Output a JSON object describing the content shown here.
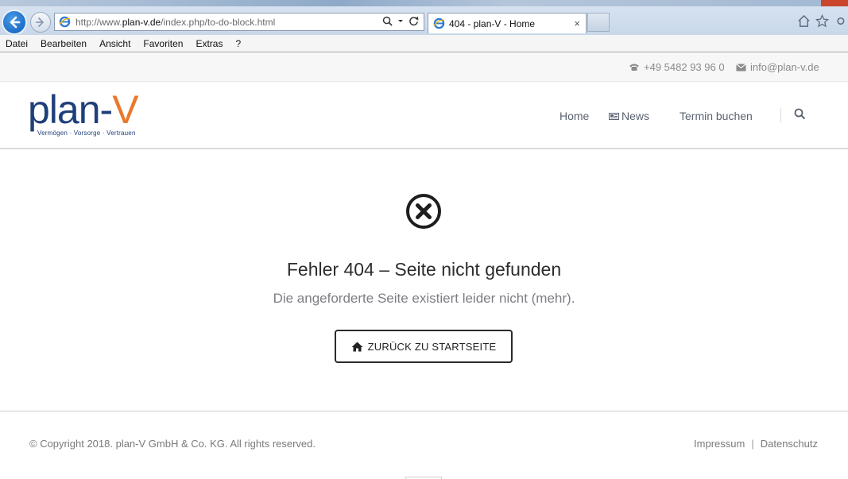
{
  "browser": {
    "url_prefix": "http://www.",
    "url_domain": "plan-v.de",
    "url_path": "/index.php/to-do-block.html",
    "tab_title": "404 - plan-V - Home",
    "tab_close": "×",
    "menu": [
      "Datei",
      "Bearbeiten",
      "Ansicht",
      "Favoriten",
      "Extras",
      "?"
    ]
  },
  "topbar": {
    "phone": "+49 5482 93 96 0",
    "email": "info@plan-v.de"
  },
  "logo": {
    "part1": "plan-",
    "part2": "V",
    "tagline": "Vermögen · Vorsorge · Vertrauen"
  },
  "nav": {
    "home": "Home",
    "news": "News",
    "termin": "Termin buchen"
  },
  "error": {
    "title": "Fehler 404 – Seite nicht gefunden",
    "text": "Die angeforderte Seite existiert leider nicht (mehr).",
    "button": "ZURÜCK ZU STARTSEITE"
  },
  "footer": {
    "copyright": "© Copyright 2018. plan-V GmbH & Co. KG. All rights reserved.",
    "impressum": "Impressum",
    "separator": "|",
    "datenschutz": "Datenschutz"
  },
  "colors": {
    "logo_blue": "#1f3f7a",
    "logo_orange": "#e8792e"
  }
}
